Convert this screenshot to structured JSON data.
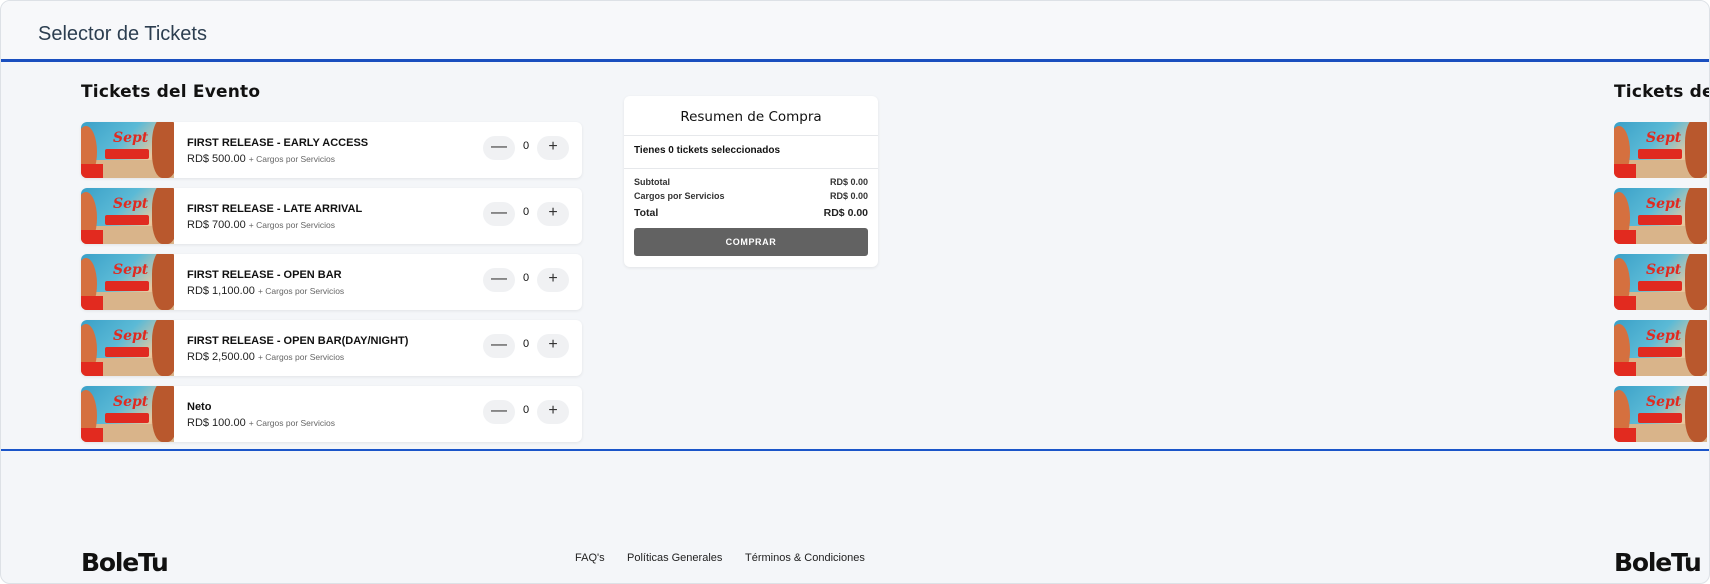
{
  "header": {
    "title": "Selector de Tickets"
  },
  "tickets_section": {
    "title": "Tickets del Evento"
  },
  "mirror_section": {
    "title": "Tickets del Evento"
  },
  "tickets": [
    {
      "name": "FIRST RELEASE - EARLY ACCESS",
      "price": "RD$ 500.00",
      "fee_note": "+ Cargos por Servicios",
      "quantity": "0",
      "image_logo": "Sept"
    },
    {
      "name": "FIRST RELEASE - LATE ARRIVAL",
      "price": "RD$ 700.00",
      "fee_note": "+ Cargos por Servicios",
      "quantity": "0",
      "image_logo": "Sept"
    },
    {
      "name": "FIRST RELEASE - OPEN BAR",
      "price": "RD$ 1,100.00",
      "fee_note": "+ Cargos por Servicios",
      "quantity": "0",
      "image_logo": "Sept"
    },
    {
      "name": "FIRST RELEASE - OPEN BAR(DAY/NIGHT)",
      "price": "RD$ 2,500.00",
      "fee_note": "+ Cargos por Servicios",
      "quantity": "0",
      "image_logo": "Sept"
    },
    {
      "name": "Neto",
      "price": "RD$ 100.00",
      "fee_note": "+ Cargos por Servicios",
      "quantity": "0",
      "image_logo": "Sept"
    }
  ],
  "stepper": {
    "minus": "—",
    "plus": "+"
  },
  "summary": {
    "title": "Resumen de Compra",
    "count_text": "Tienes 0 tickets seleccionados",
    "subtotal_label": "Subtotal",
    "subtotal_value": "RD$ 0.00",
    "fees_label": "Cargos por Servicios",
    "fees_value": "RD$ 0.00",
    "total_label": "Total",
    "total_value": "RD$ 0.00",
    "buy_label": "COMPRAR"
  },
  "footer": {
    "brand": "BoleTu",
    "links": [
      "FAQ's",
      "Políticas Generales",
      "Términos & Condiciones"
    ]
  },
  "colors": {
    "accent": "#1a4fbf",
    "buy_button": "#626262",
    "background": "#f4f6f9"
  }
}
